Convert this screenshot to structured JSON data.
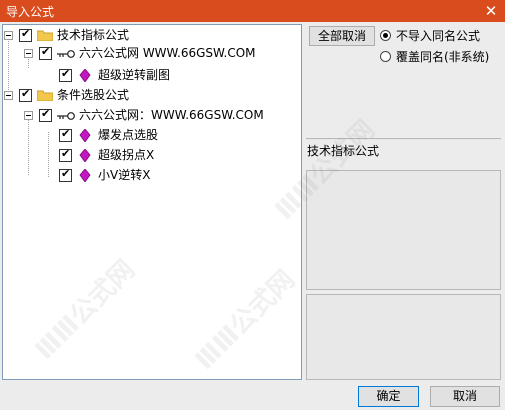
{
  "window": {
    "title": "导入公式",
    "close_glyph": "✕"
  },
  "tree": [
    {
      "level": 0,
      "type": "folder",
      "label": "技术指标公式",
      "checked": true,
      "expandable": true
    },
    {
      "level": 1,
      "type": "key",
      "label": "六六公式网 WWW.66GSW.COM",
      "checked": true,
      "expandable": true
    },
    {
      "level": 2,
      "type": "gem",
      "label": "超级逆转副图",
      "checked": true,
      "expandable": false
    },
    {
      "level": 0,
      "type": "folder",
      "label": "条件选股公式",
      "checked": true,
      "expandable": true
    },
    {
      "level": 1,
      "type": "key",
      "label": "六六公式网：WWW.66GSW.COM",
      "checked": true,
      "expandable": true
    },
    {
      "level": 2,
      "type": "gem",
      "label": "爆发点选股",
      "checked": true,
      "expandable": false
    },
    {
      "level": 2,
      "type": "gem",
      "label": "超级拐点X",
      "checked": true,
      "expandable": false
    },
    {
      "level": 2,
      "type": "gem",
      "label": "小V逆转X",
      "checked": true,
      "expandable": false
    }
  ],
  "right": {
    "cancel_all_label": "全部取消",
    "radio_options": [
      {
        "label": "不导入同名公式",
        "selected": true
      },
      {
        "label": "覆盖同名(非系统)",
        "selected": false
      }
    ],
    "info_label": "技术指标公式"
  },
  "footer": {
    "ok_label": "确定",
    "cancel_label": "取消"
  },
  "watermark_text": "ⅢⅢ公式网"
}
